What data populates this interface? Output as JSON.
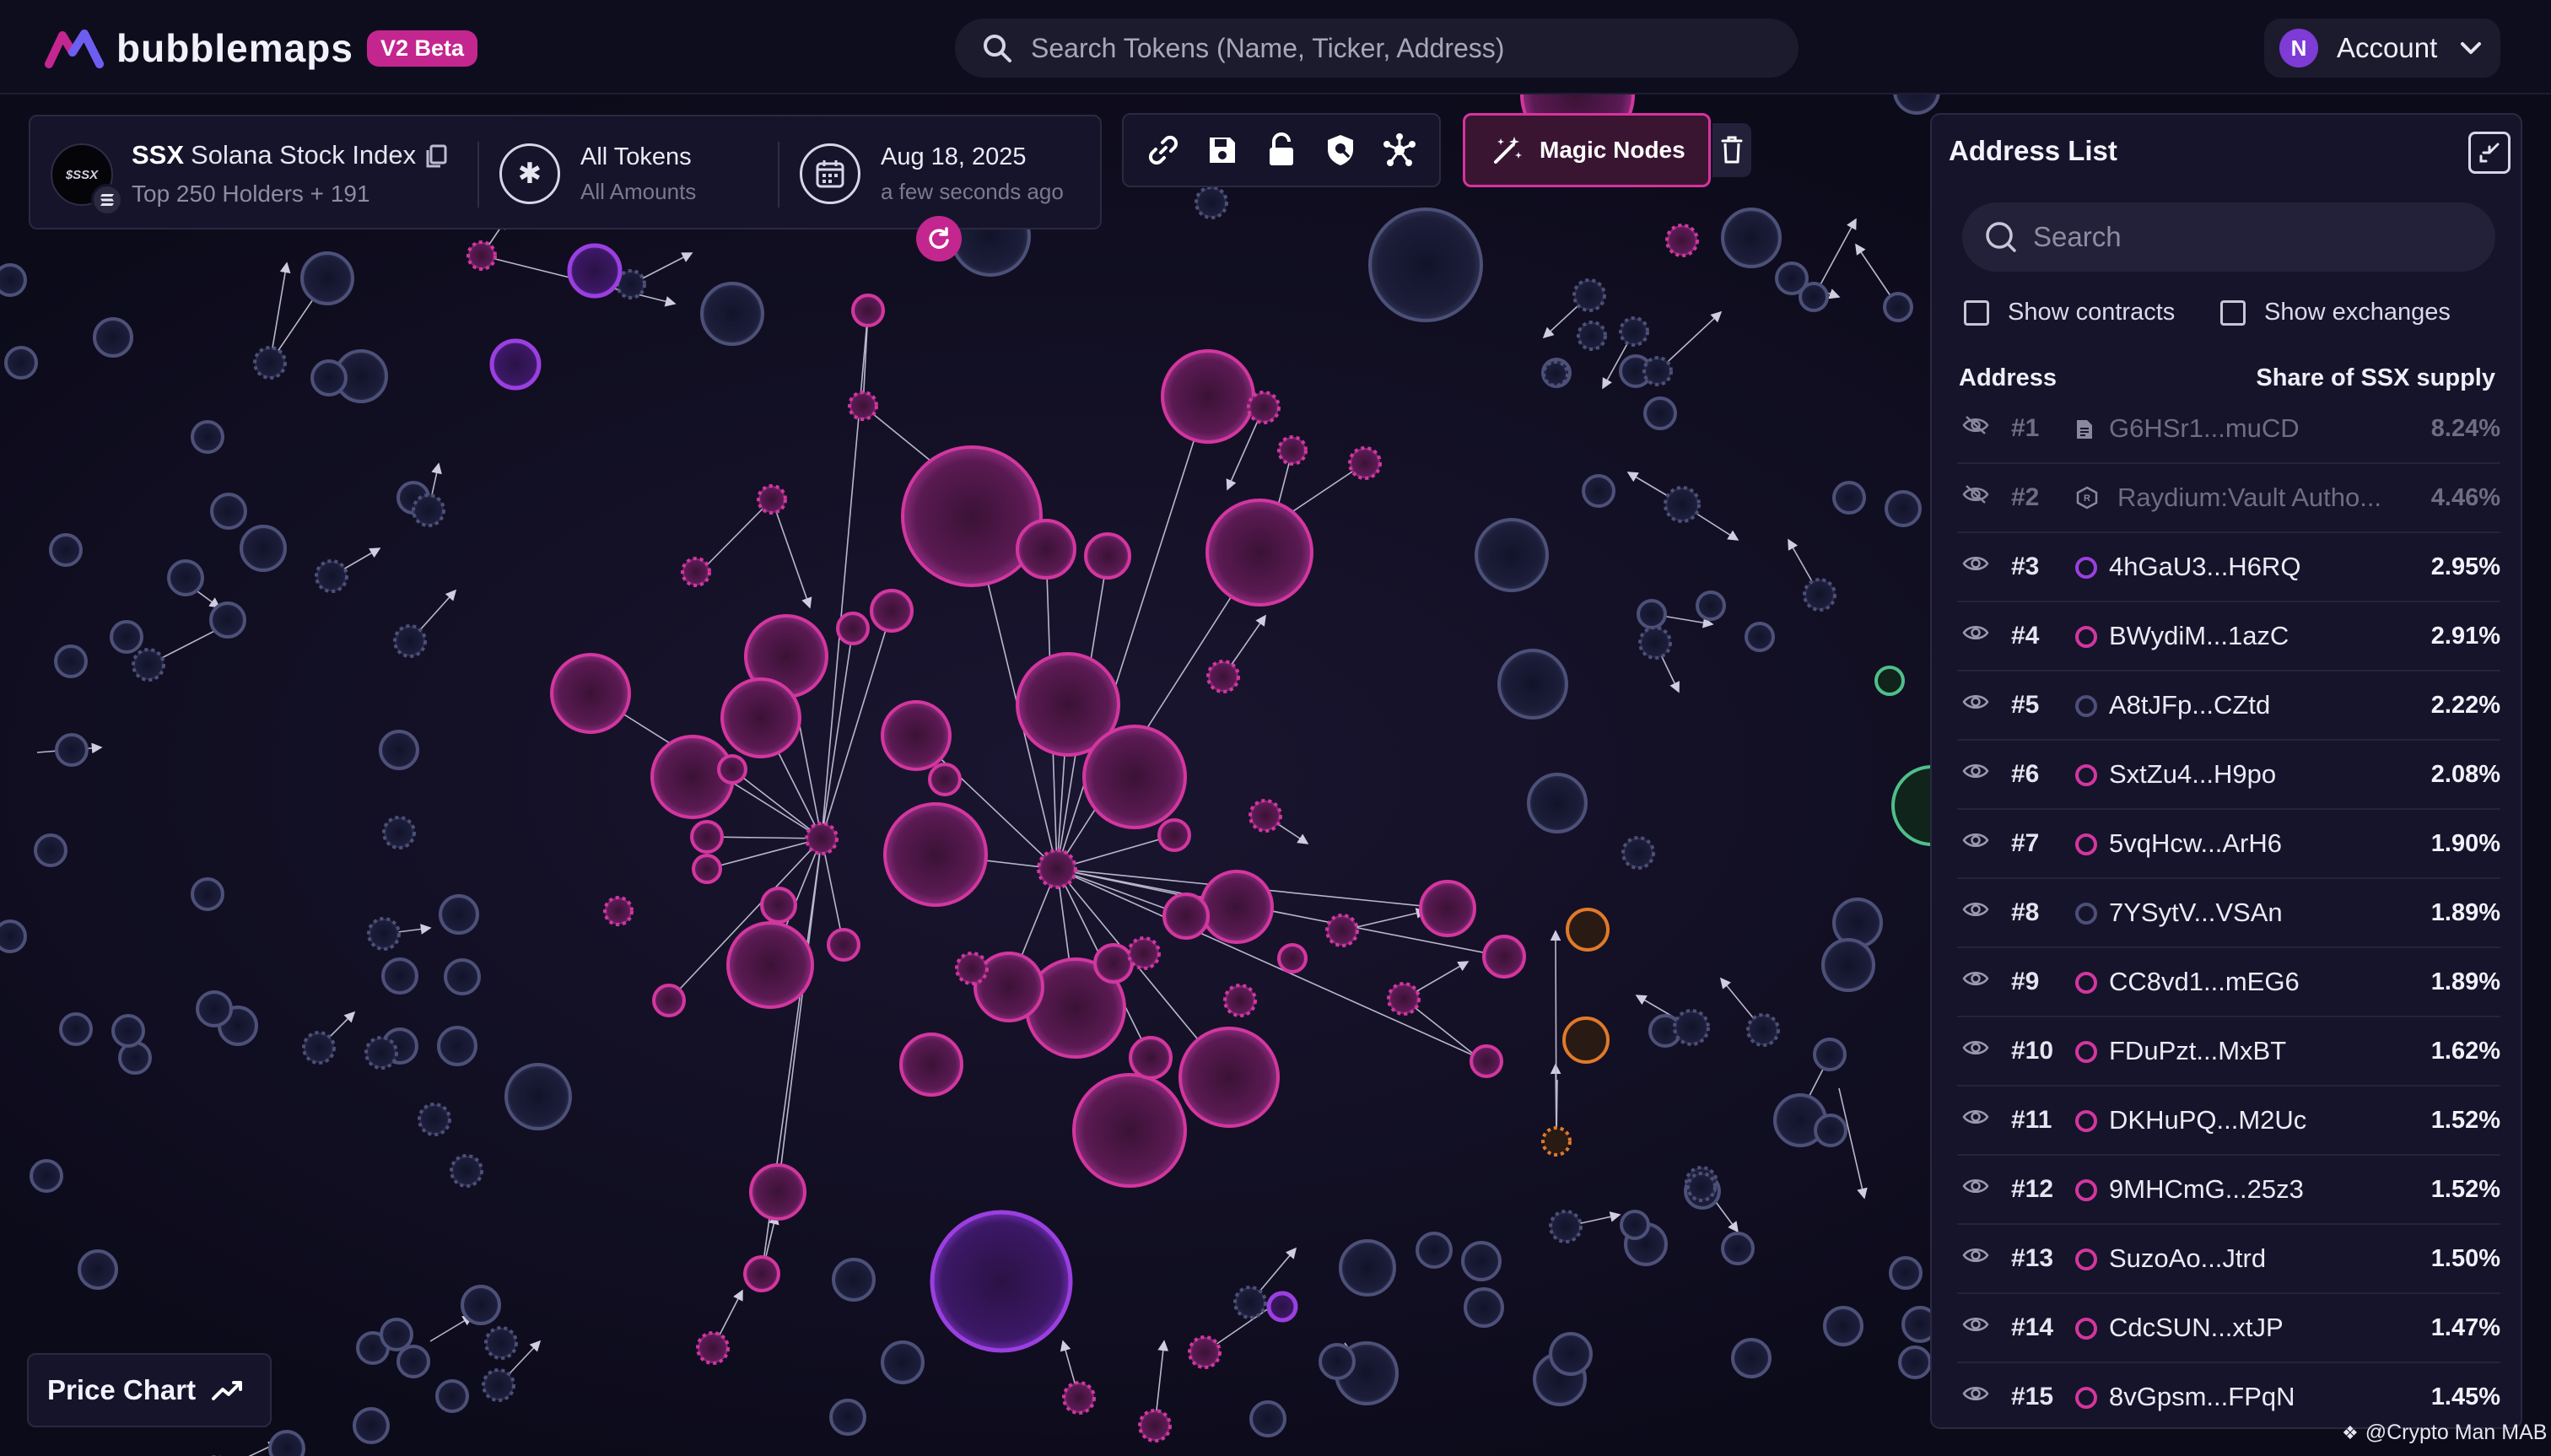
{
  "app": {
    "name": "bubblemaps",
    "badge": "V2 Beta",
    "colors": {
      "accent": "#c4268f",
      "background": "#0c0b1a",
      "panel": "#15142a"
    }
  },
  "search": {
    "placeholder": "Search Tokens (Name, Ticker, Address)",
    "icon": "search-icon"
  },
  "account": {
    "initial": "N",
    "label": "Account",
    "icon": "chevron-down-icon"
  },
  "token": {
    "ticker": "SSX",
    "name": "Solana Stock Index",
    "holders": "Top 250 Holders + 191",
    "logo_text": "$SSX",
    "chain_icon": "solana-icon"
  },
  "filter": {
    "title": "All Tokens",
    "subtitle": "All Amounts"
  },
  "date": {
    "title": "Aug 18, 2025",
    "subtitle": "a few seconds ago"
  },
  "toolbar": {
    "icons": [
      "link-icon",
      "save-icon",
      "lock-icon",
      "shield-icon",
      "network-icon"
    ],
    "magic_label": "Magic Nodes",
    "delete_icon": "trash-icon"
  },
  "address_list": {
    "title": "Address List",
    "search_placeholder": "Search",
    "show_contracts": "Show contracts",
    "show_exchanges": "Show exchanges",
    "col_address": "Address",
    "col_share": "Share of SSX supply",
    "rows": [
      {
        "rank": "#1",
        "address": "G6HSr1...muCD",
        "share": "8.24%",
        "hidden": true,
        "tag": "contract"
      },
      {
        "rank": "#2",
        "address": "Raydium:Vault Autho...",
        "share": "4.46%",
        "hidden": true,
        "tag": "exchange"
      },
      {
        "rank": "#3",
        "address": "4hGaU3...H6RQ",
        "share": "2.95%",
        "hidden": false,
        "tag": "#9b3fe0"
      },
      {
        "rank": "#4",
        "address": "BWydiM...1azC",
        "share": "2.91%",
        "hidden": false,
        "tag": "#d3369f"
      },
      {
        "rank": "#5",
        "address": "A8tJFp...CZtd",
        "share": "2.22%",
        "hidden": false,
        "tag": "#4c4f78"
      },
      {
        "rank": "#6",
        "address": "SxtZu4...H9po",
        "share": "2.08%",
        "hidden": false,
        "tag": "#d3369f"
      },
      {
        "rank": "#7",
        "address": "5vqHcw...ArH6",
        "share": "1.90%",
        "hidden": false,
        "tag": "#d3369f"
      },
      {
        "rank": "#8",
        "address": "7YSytV...VSAn",
        "share": "1.89%",
        "hidden": false,
        "tag": "#4c4f78"
      },
      {
        "rank": "#9",
        "address": "CC8vd1...mEG6",
        "share": "1.89%",
        "hidden": false,
        "tag": "#d3369f"
      },
      {
        "rank": "#10",
        "address": "FDuPzt...MxBT",
        "share": "1.62%",
        "hidden": false,
        "tag": "#d3369f"
      },
      {
        "rank": "#11",
        "address": "DKHuPQ...M2Uc",
        "share": "1.52%",
        "hidden": false,
        "tag": "#d3369f"
      },
      {
        "rank": "#12",
        "address": "9MHCmG...25z3",
        "share": "1.52%",
        "hidden": false,
        "tag": "#d3369f"
      },
      {
        "rank": "#13",
        "address": "SuzoAo...Jtrd",
        "share": "1.50%",
        "hidden": false,
        "tag": "#d3369f"
      },
      {
        "rank": "#14",
        "address": "CdcSUN...xtJP",
        "share": "1.47%",
        "hidden": false,
        "tag": "#d3369f"
      },
      {
        "rank": "#15",
        "address": "8vGpsm...FPqN",
        "share": "1.45%",
        "hidden": false,
        "tag": "#d3369f"
      }
    ]
  },
  "price_chart": {
    "label": "Price Chart",
    "icon": "trend-line-icon"
  },
  "watermark": "@Crypto Man MAB"
}
